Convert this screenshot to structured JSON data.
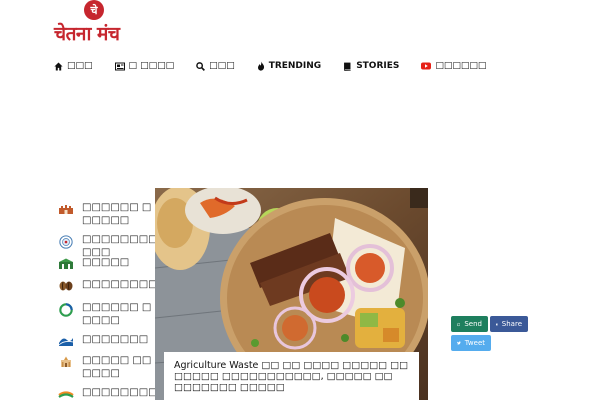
{
  "logo": {
    "badge": "चे",
    "text": "चेतना मंच"
  },
  "nav": {
    "items": [
      {
        "label": "□□□",
        "icon": "home-icon"
      },
      {
        "label": "□ □□□□",
        "icon": "newspaper-icon"
      },
      {
        "label": "□□□",
        "icon": "search-icon"
      },
      {
        "label": "TRENDING",
        "icon": "fire-icon"
      },
      {
        "label": "STORIES",
        "icon": "book-icon"
      },
      {
        "label": "□□□□□□",
        "icon": "youtube-icon"
      }
    ]
  },
  "sidebar": {
    "items": [
      {
        "label": "□□□□□□ □□□□□□",
        "icon": "fort-icon"
      },
      {
        "label": "□□□□□□□□□□□",
        "icon": "seal-icon"
      },
      {
        "label": "□□□□□",
        "icon": "building-icon"
      },
      {
        "label": "□□□□□□□□",
        "icon": "coffee-bean-icon"
      },
      {
        "label": "□□□□□□ □□□□□",
        "icon": "circle-logo-icon"
      },
      {
        "label": "□□□□□□□",
        "icon": "wave-icon"
      },
      {
        "label": "□□□□□ □□□□□□",
        "icon": "temple-icon"
      },
      {
        "label": "□□□□□□□□",
        "icon": "flag-icon"
      }
    ]
  },
  "feature": {
    "caption": "Agriculture Waste □□ □□ □□□□ □□□□□ □□ □□□□□ □□□□□□□□□□□, □□□□□ □□ □□□□□□□ □□□□□"
  },
  "share": {
    "whatsapp": "Send",
    "facebook": "Share",
    "twitter": "Tweet"
  }
}
